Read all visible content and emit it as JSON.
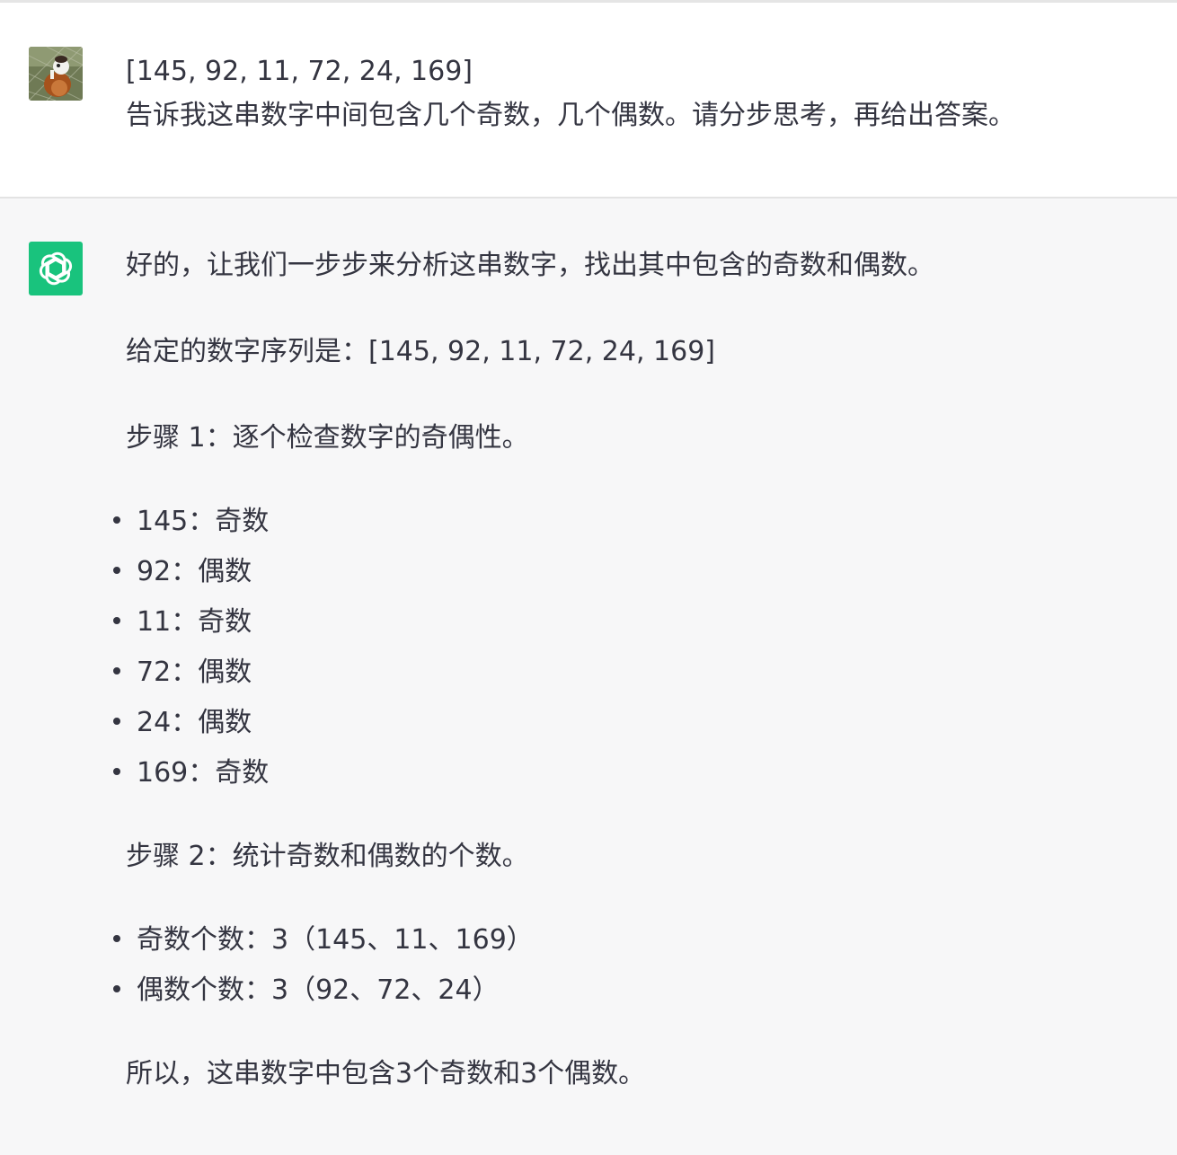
{
  "user_message": {
    "line1": "[145, 92, 11, 72, 24, 169]",
    "line2": "告诉我这串数字中间包含几个奇数，几个偶数。请分步思考，再给出答案。"
  },
  "assistant_message": {
    "intro": "好的，让我们一步步来分析这串数字，找出其中包含的奇数和偶数。",
    "sequence": "给定的数字序列是：[145, 92, 11, 72, 24, 169]",
    "step1": "步骤 1：逐个检查数字的奇偶性。",
    "step1_items": [
      "145：奇数",
      "92：偶数",
      "11：奇数",
      "72：偶数",
      "24：偶数",
      "169：奇数"
    ],
    "step2": "步骤 2：统计奇数和偶数的个数。",
    "step2_items": [
      "奇数个数：3（145、11、169）",
      "偶数个数：3（92、72、24）"
    ],
    "conclusion": "所以，这串数字中包含3个奇数和3个偶数。"
  },
  "icons": {
    "user_avatar": "user-avatar-photo",
    "assistant_avatar": "openai-logo-icon"
  },
  "colors": {
    "assistant_bg": "#f7f7f8",
    "assistant_avatar_bg": "#19c37d",
    "text": "#343541"
  }
}
